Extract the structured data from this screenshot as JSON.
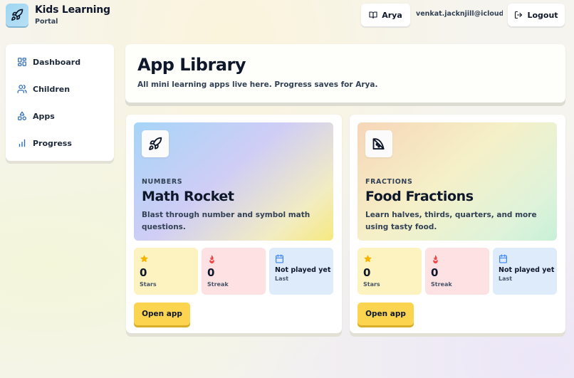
{
  "brand": {
    "title": "Kids Learning",
    "subtitle": "Portal"
  },
  "header": {
    "user_name": "Arya",
    "email": "venkat.jacknjill@icloud...",
    "logout_label": "Logout"
  },
  "sidebar": {
    "items": [
      {
        "label": "Dashboard",
        "icon": "dashboard-icon"
      },
      {
        "label": "Children",
        "icon": "users-icon"
      },
      {
        "label": "Apps",
        "icon": "shapes-icon"
      },
      {
        "label": "Progress",
        "icon": "bar-chart-icon"
      }
    ]
  },
  "page": {
    "title": "App Library",
    "subtitle": "All mini learning apps live here. Progress saves for Arya."
  },
  "apps": [
    {
      "category": "NUMBERS",
      "name": "Math Rocket",
      "description": "Blast through number and symbol math questions.",
      "icon": "rocket-icon",
      "stars_value": "0",
      "stars_label": "Stars",
      "streak_value": "0",
      "streak_label": "Streak",
      "last_value": "Not played yet",
      "last_label": "Last",
      "open_label": "Open app"
    },
    {
      "category": "FRACTIONS",
      "name": "Food Fractions",
      "description": "Learn halves, thirds, quarters, and more using tasty food.",
      "icon": "pizza-slice-icon",
      "stars_value": "0",
      "stars_label": "Stars",
      "streak_value": "0",
      "streak_label": "Streak",
      "last_value": "Not played yet",
      "last_label": "Last",
      "open_label": "Open app"
    }
  ],
  "colors": {
    "accent_yellow": "#fcd44f",
    "stars_bg": "#fdf3c0",
    "streak_bg": "#fde1e3",
    "last_bg": "#ddebfb",
    "star_icon": "#f5b400",
    "flame_icon": "#ef4444",
    "calendar_icon": "#3b82f6",
    "nav_icon": "#2f6db5"
  }
}
